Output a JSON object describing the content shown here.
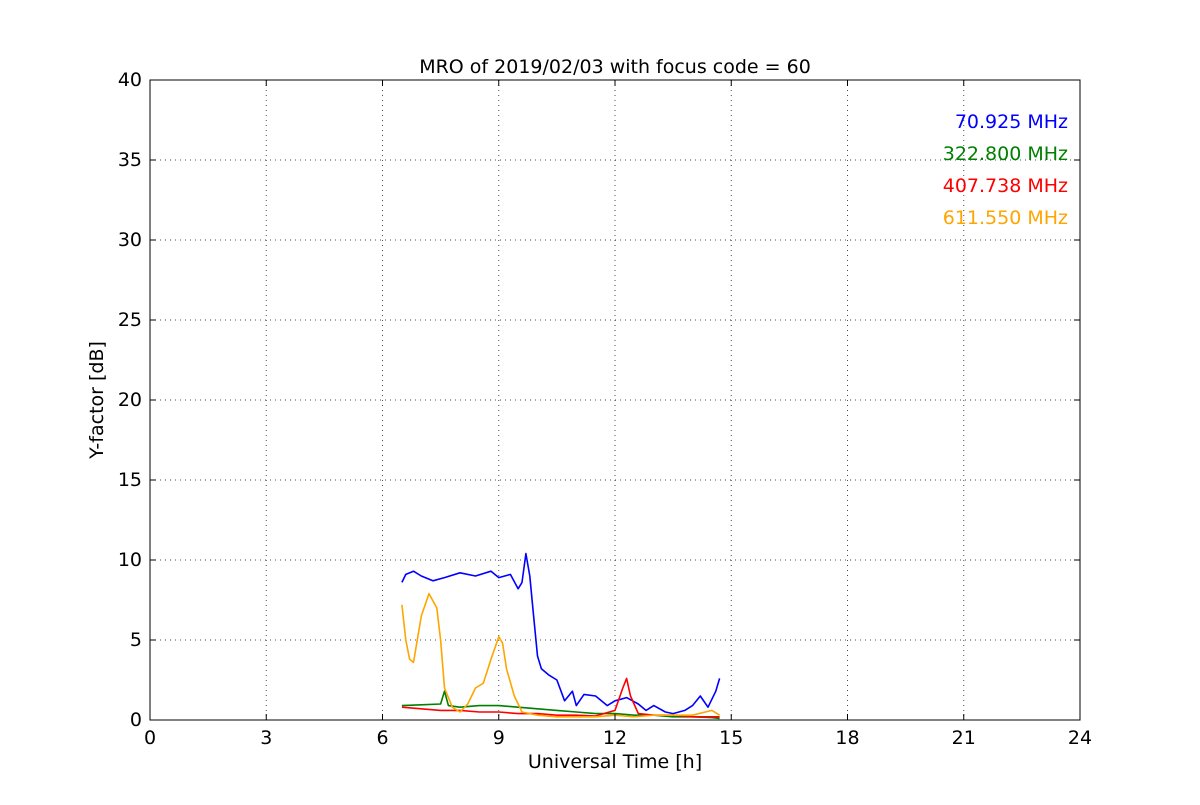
{
  "chart_data": {
    "type": "line",
    "title": "MRO of 2019/02/03 with focus code = 60",
    "xlabel": "Universal Time [h]",
    "ylabel": "Y-factor [dB]",
    "xlim": [
      0,
      24
    ],
    "ylim": [
      0,
      40
    ],
    "xticks": [
      0,
      3,
      6,
      9,
      12,
      15,
      18,
      21,
      24
    ],
    "yticks": [
      0,
      5,
      10,
      15,
      20,
      25,
      30,
      35,
      40
    ],
    "grid": true,
    "legend_position": "top-right",
    "series": [
      {
        "name": "70.925 MHz",
        "color": "#0000ff",
        "x": [
          6.5,
          6.6,
          6.8,
          7.0,
          7.3,
          7.6,
          8.0,
          8.4,
          8.8,
          9.0,
          9.3,
          9.5,
          9.6,
          9.7,
          9.8,
          9.9,
          10.0,
          10.1,
          10.3,
          10.5,
          10.7,
          10.9,
          11.0,
          11.2,
          11.5,
          11.8,
          12.0,
          12.3,
          12.6,
          12.8,
          13.0,
          13.3,
          13.5,
          13.8,
          14.0,
          14.2,
          14.4,
          14.6,
          14.7
        ],
        "y": [
          8.6,
          9.1,
          9.3,
          9.0,
          8.7,
          8.9,
          9.2,
          9.0,
          9.3,
          8.9,
          9.1,
          8.2,
          8.6,
          10.4,
          9.0,
          6.5,
          4.0,
          3.2,
          2.8,
          2.5,
          1.2,
          1.8,
          0.9,
          1.6,
          1.5,
          0.9,
          1.2,
          1.4,
          1.0,
          0.6,
          0.9,
          0.5,
          0.4,
          0.6,
          0.9,
          1.5,
          0.8,
          1.8,
          2.6
        ]
      },
      {
        "name": "322.800 MHz",
        "color": "#008000",
        "x": [
          6.5,
          7.0,
          7.5,
          7.6,
          7.7,
          8.0,
          8.5,
          9.0,
          9.5,
          10.0,
          10.5,
          11.0,
          11.5,
          12.0,
          12.5,
          13.0,
          13.5,
          14.0,
          14.5,
          14.7
        ],
        "y": [
          0.9,
          0.95,
          1.0,
          1.8,
          0.9,
          0.8,
          0.9,
          0.9,
          0.8,
          0.7,
          0.6,
          0.5,
          0.4,
          0.4,
          0.3,
          0.3,
          0.2,
          0.2,
          0.15,
          0.1
        ]
      },
      {
        "name": "407.738 MHz",
        "color": "#ff0000",
        "x": [
          6.5,
          7.0,
          7.5,
          8.0,
          8.5,
          9.0,
          9.5,
          10.0,
          10.5,
          11.0,
          11.5,
          12.0,
          12.2,
          12.3,
          12.4,
          12.6,
          13.0,
          13.5,
          14.0,
          14.5,
          14.7
        ],
        "y": [
          0.8,
          0.7,
          0.6,
          0.6,
          0.5,
          0.5,
          0.4,
          0.4,
          0.3,
          0.3,
          0.25,
          0.6,
          2.0,
          2.6,
          1.5,
          0.4,
          0.3,
          0.3,
          0.2,
          0.2,
          0.2
        ]
      },
      {
        "name": "611.550 MHz",
        "color": "#ffa500",
        "x": [
          6.5,
          6.6,
          6.7,
          6.8,
          7.0,
          7.2,
          7.4,
          7.5,
          7.6,
          7.8,
          8.0,
          8.2,
          8.4,
          8.6,
          8.8,
          9.0,
          9.1,
          9.2,
          9.4,
          9.6,
          10.0,
          10.5,
          11.0,
          11.5,
          12.0,
          12.5,
          13.0,
          13.5,
          14.0,
          14.5,
          14.7
        ],
        "y": [
          7.2,
          5.0,
          3.8,
          3.6,
          6.5,
          7.9,
          7.0,
          5.0,
          2.0,
          0.8,
          0.5,
          1.0,
          2.0,
          2.3,
          3.8,
          5.2,
          4.8,
          3.2,
          1.5,
          0.5,
          0.3,
          0.2,
          0.2,
          0.2,
          0.3,
          0.2,
          0.3,
          0.3,
          0.3,
          0.6,
          0.3
        ]
      }
    ]
  }
}
